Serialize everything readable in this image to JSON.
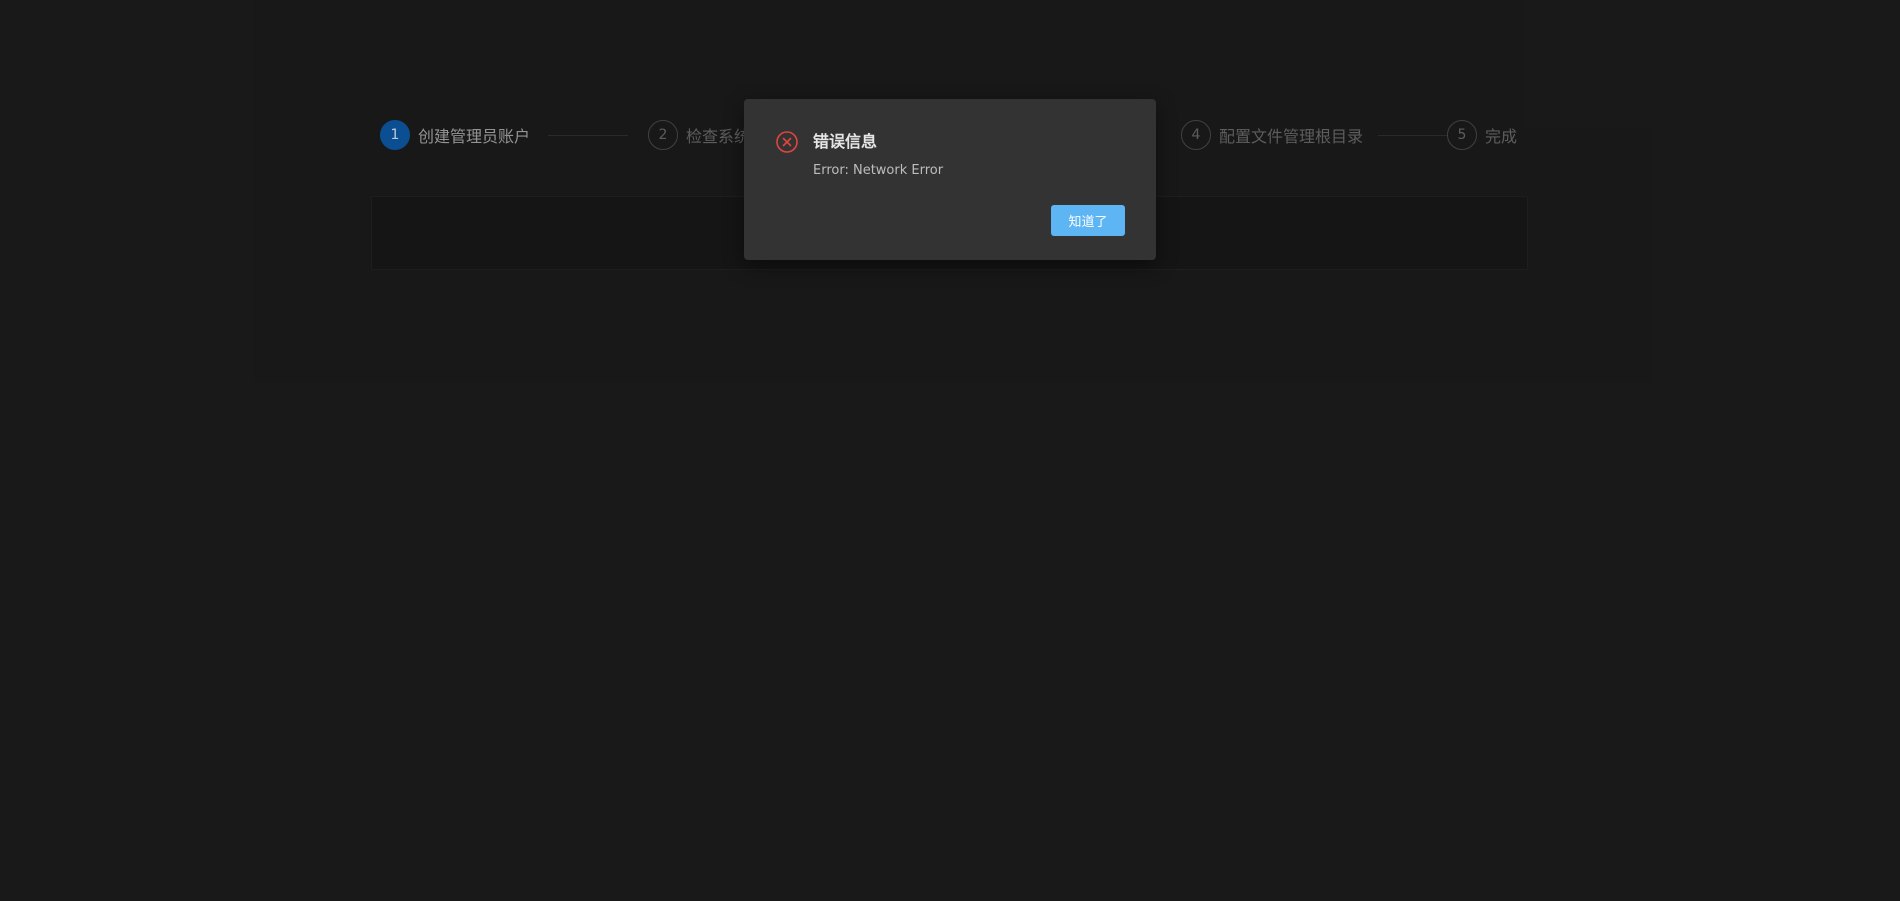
{
  "steps": [
    {
      "number": "1",
      "label": "创建管理员账户",
      "active": true
    },
    {
      "number": "2",
      "label": "检查系统",
      "active": false
    },
    {
      "number": "4",
      "label": "配置文件管理根目录",
      "active": false
    },
    {
      "number": "5",
      "label": "完成",
      "active": false
    }
  ],
  "dialog": {
    "title": "错误信息",
    "message": "Error: Network Error",
    "confirm_label": "知道了",
    "icon": "error-circle-icon"
  },
  "colors": {
    "background": "#1c1c1c",
    "active_step": "#0d5aa7",
    "dialog_bg": "#333333",
    "error_red": "#e0453f",
    "button_blue": "#5eb5f3"
  }
}
